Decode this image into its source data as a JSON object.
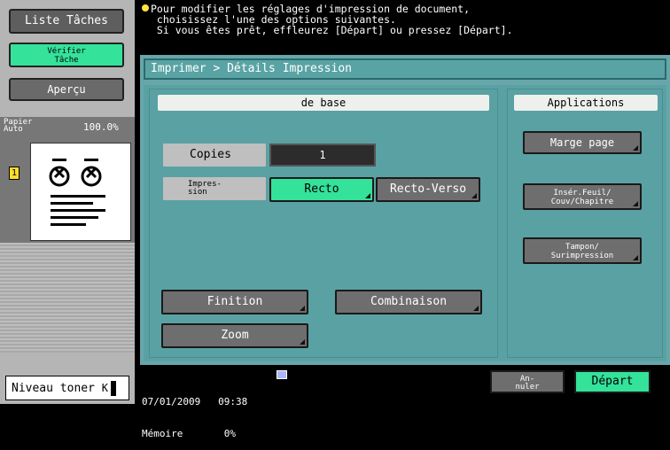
{
  "sidebar": {
    "liste_taches": "Liste Tâches",
    "verifier_tache": "Vérifier\nTâche",
    "apercu": "Aperçu",
    "papier": "Papier\nAuto",
    "zoom": "100.0%",
    "page_badge": "1",
    "toner": "Niveau toner"
  },
  "message": {
    "text": "Pour modifier les réglages d'impression de document,\n choisissez l'une des options suivantes.\n Si vous êtes prêt, effleurez [Départ] ou pressez [Départ]."
  },
  "header": {
    "breadcrumb": "Imprimer > Détails Impression"
  },
  "tabs": {
    "base": "de base",
    "applications": "Applications"
  },
  "settings": {
    "copies_label": "Copies",
    "copies_value": "1",
    "impression_label": "Impres-\nsion",
    "recto": "Recto",
    "recto_verso": "Recto-Verso",
    "finition": "Finition",
    "combinaison": "Combinaison",
    "zoom": "Zoom"
  },
  "applications": {
    "marge_page": "Marge page",
    "inser_feuil": "Insér.Feuil/\nCouv/Chapitre",
    "tampon": "Tampon/\nSurimpression"
  },
  "status": {
    "date_time": "07/01/2009   09:38",
    "memoire": "Mémoire       0%",
    "annuler": "An-\nnuler",
    "depart": "Départ"
  },
  "colors": {
    "accent": "#34e29a",
    "panel": "#5aa1a3",
    "header": "#67a6a9"
  }
}
